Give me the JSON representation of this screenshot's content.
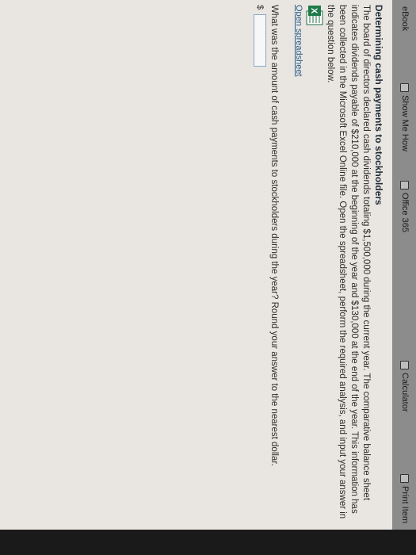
{
  "toolbar": {
    "ebook": "eBook",
    "show_me_how": "Show Me How",
    "office365": "Office 365",
    "calculator": "Calculator",
    "print_item": "Print Item"
  },
  "content": {
    "title": "Determining cash payments to stockholders",
    "paragraph": "The board of directors declared cash dividends totaling $1,500,000 during the current year. The comparative balance sheet indicates dividends payable of $210,000 at the beginning of the year and $130,000 at the end of the year. This information has been collected in the Microsoft Excel Online file. Open the spreadsheet, perform the required analysis, and input your answer in the question below.",
    "open_spreadsheet": "Open spreadsheet",
    "question": "What was the amount of cash payments to stockholders during the year? Round your answer to the nearest dollar.",
    "currency": "$",
    "answer_value": ""
  }
}
